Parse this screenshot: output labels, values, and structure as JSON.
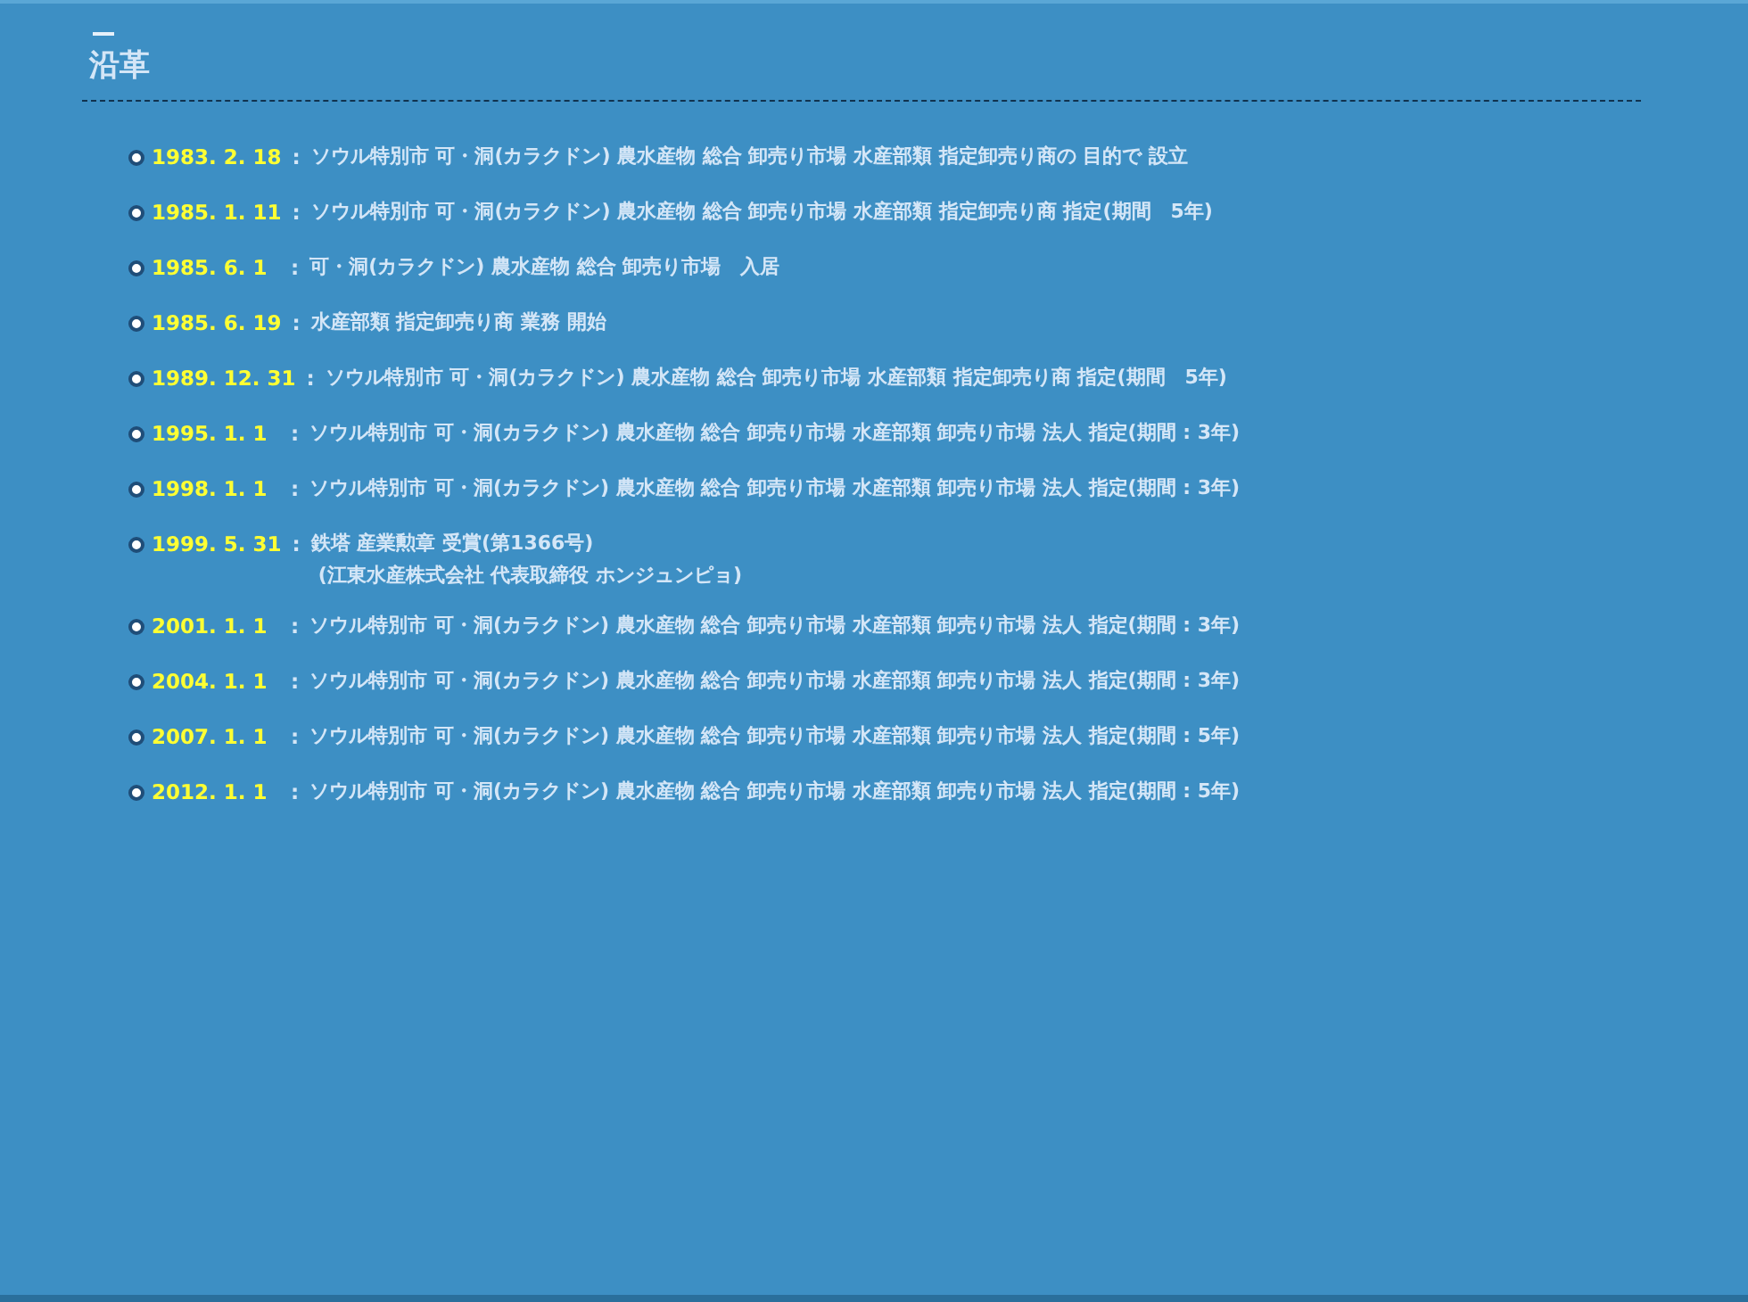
{
  "section": {
    "title": "沿革"
  },
  "entries": [
    {
      "date": "1983. 2. 18",
      "separator": ":",
      "lines": [
        "ソウル特別市 可・洞(カラクドン) 農水産物 総合 卸売り市場 水産部類 指定卸売り商の 目的で 設立"
      ]
    },
    {
      "date": "1985. 1. 11",
      "separator": ":",
      "lines": [
        "ソウル特別市 可・洞(カラクドン) 農水産物 総合 卸売り市場 水産部類 指定卸売り商 指定(期間　5年)"
      ]
    },
    {
      "date": "1985. 6. 1",
      "separator": ":",
      "lines": [
        "可・洞(カラクドン) 農水産物 総合 卸売り市場　入居"
      ]
    },
    {
      "date": "1985. 6. 19",
      "separator": ":",
      "lines": [
        "水産部類 指定卸売り商 業務 開始"
      ]
    },
    {
      "date": "1989. 12. 31",
      "separator": ":",
      "lines": [
        "ソウル特別市 可・洞(カラクドン) 農水産物 総合 卸売り市場 水産部類 指定卸売り商 指定(期間　5年)"
      ]
    },
    {
      "date": "1995. 1. 1",
      "separator": ":",
      "lines": [
        "ソウル特別市 可・洞(カラクドン) 農水産物 総合 卸売り市場 水産部類 卸売り市場 法人 指定(期間 : 3年)"
      ]
    },
    {
      "date": "1998. 1. 1",
      "separator": ":",
      "lines": [
        "ソウル特別市 可・洞(カラクドン) 農水産物 総合 卸売り市場 水産部類 卸売り市場 法人 指定(期間 : 3年)"
      ]
    },
    {
      "date": "1999. 5. 31",
      "separator": ":",
      "lines": [
        "鉄塔 産業勲章 受賞(第1366号)",
        "(江東水産株式会社 代表取締役 ホンジュンピョ)"
      ]
    },
    {
      "date": "2001. 1. 1",
      "separator": ":",
      "lines": [
        "ソウル特別市 可・洞(カラクドン) 農水産物 総合 卸売り市場 水産部類 卸売り市場 法人 指定(期間 : 3年)"
      ]
    },
    {
      "date": "2004. 1. 1",
      "separator": ":",
      "lines": [
        "ソウル特別市 可・洞(カラクドン) 農水産物 総合 卸売り市場 水産部類 卸売り市場 法人 指定(期間 : 3年)"
      ]
    },
    {
      "date": "2007. 1. 1",
      "separator": ":",
      "lines": [
        "ソウル特別市 可・洞(カラクドン) 農水産物 総合 卸売り市場 水産部類 卸売り市場 法人 指定(期間 : 5年)"
      ]
    },
    {
      "date": "2012. 1. 1",
      "separator": ":",
      "lines": [
        "ソウル特別市 可・洞(カラクドン) 農水産物 総合 卸売り市場 水産部類 卸売り市場 法人 指定(期間 : 5年)"
      ]
    }
  ]
}
